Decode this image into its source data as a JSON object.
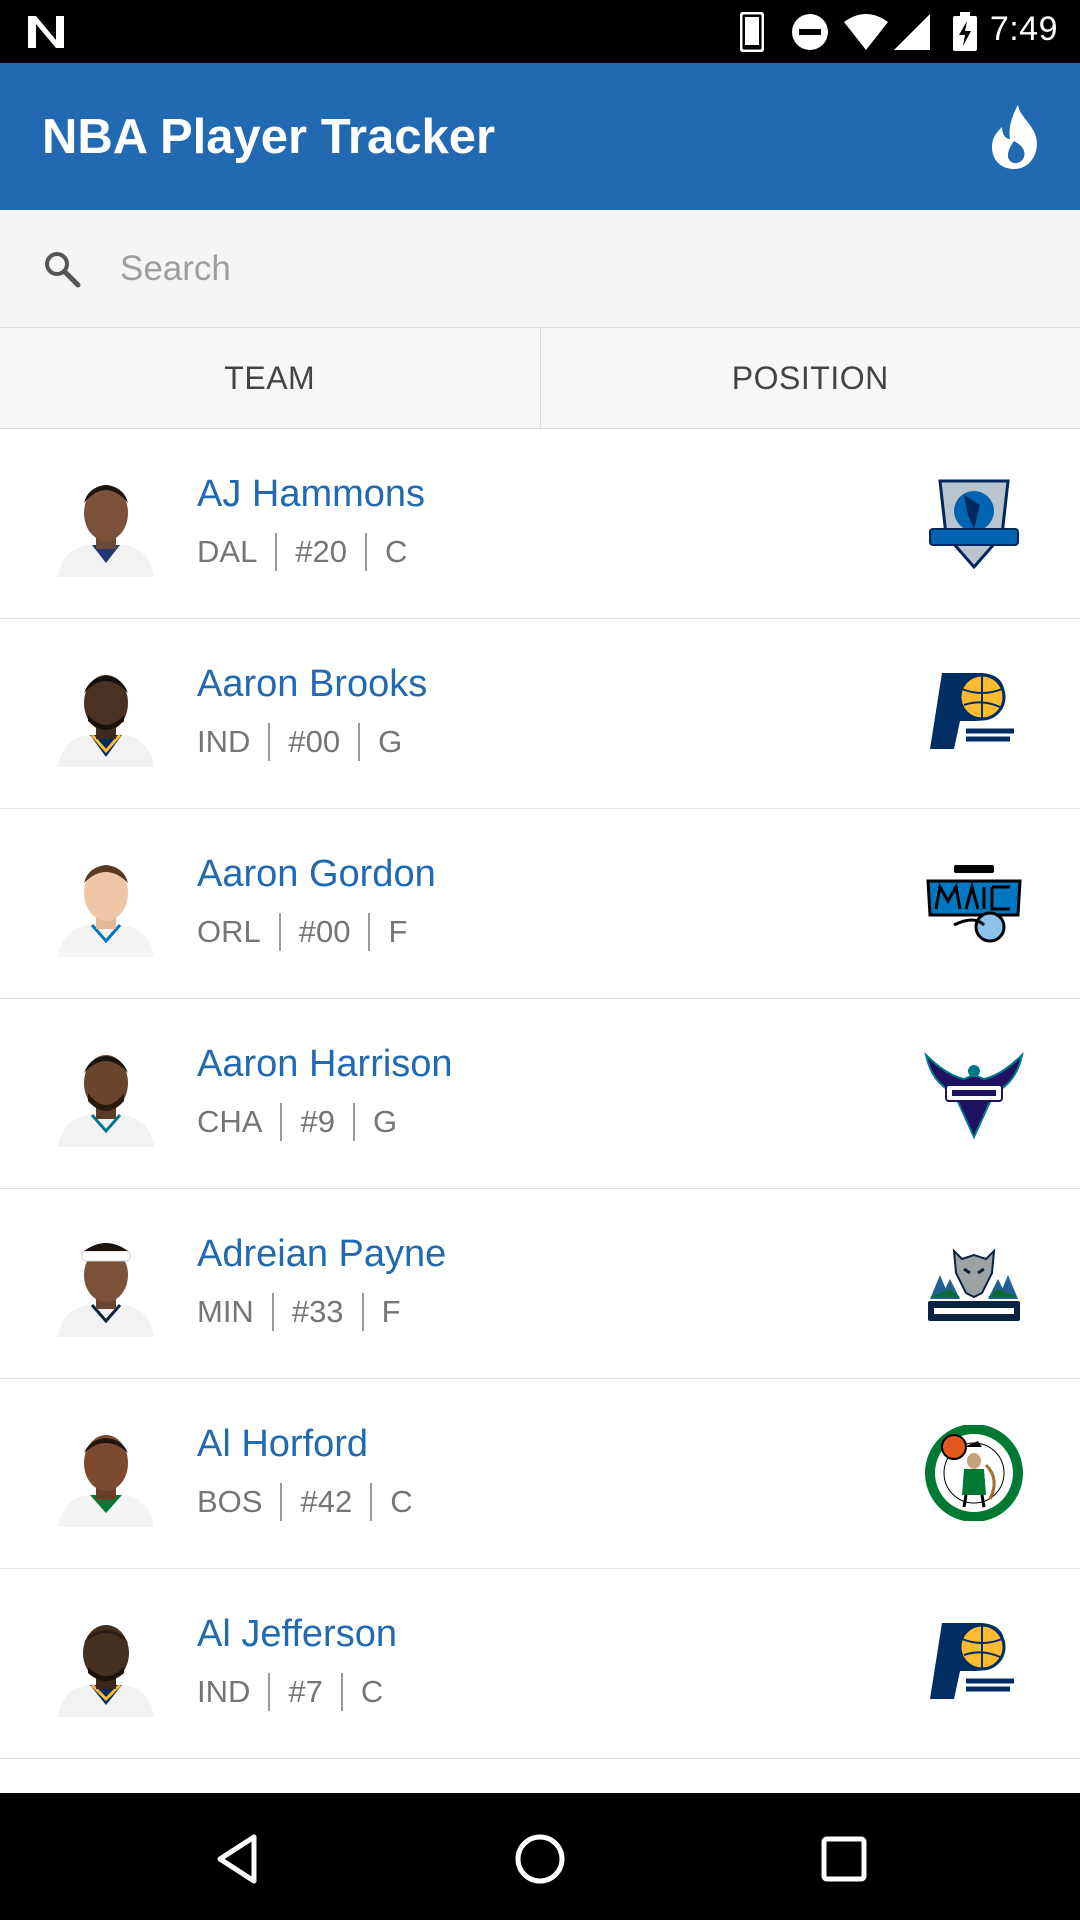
{
  "status_bar": {
    "time": "7:49"
  },
  "app_bar": {
    "title": "NBA Player Tracker",
    "action_icon": "flame-icon"
  },
  "search": {
    "placeholder": "Search",
    "value": ""
  },
  "filters": [
    {
      "label": "TEAM"
    },
    {
      "label": "POSITION"
    }
  ],
  "players": [
    {
      "name": "AJ Hammons",
      "team": "DAL",
      "number": "#20",
      "position": "C",
      "team_logo": "mavericks-logo"
    },
    {
      "name": "Aaron Brooks",
      "team": "IND",
      "number": "#00",
      "position": "G",
      "team_logo": "pacers-logo"
    },
    {
      "name": "Aaron Gordon",
      "team": "ORL",
      "number": "#00",
      "position": "F",
      "team_logo": "magic-logo"
    },
    {
      "name": "Aaron Harrison",
      "team": "CHA",
      "number": "#9",
      "position": "G",
      "team_logo": "hornets-logo"
    },
    {
      "name": "Adreian Payne",
      "team": "MIN",
      "number": "#33",
      "position": "F",
      "team_logo": "timberwolves-logo"
    },
    {
      "name": "Al Horford",
      "team": "BOS",
      "number": "#42",
      "position": "C",
      "team_logo": "celtics-logo"
    },
    {
      "name": "Al Jefferson",
      "team": "IND",
      "number": "#7",
      "position": "C",
      "team_logo": "pacers-logo"
    }
  ],
  "colors": {
    "primary": "#2169b0",
    "name_text": "#2169b0",
    "meta_text": "#757575"
  }
}
